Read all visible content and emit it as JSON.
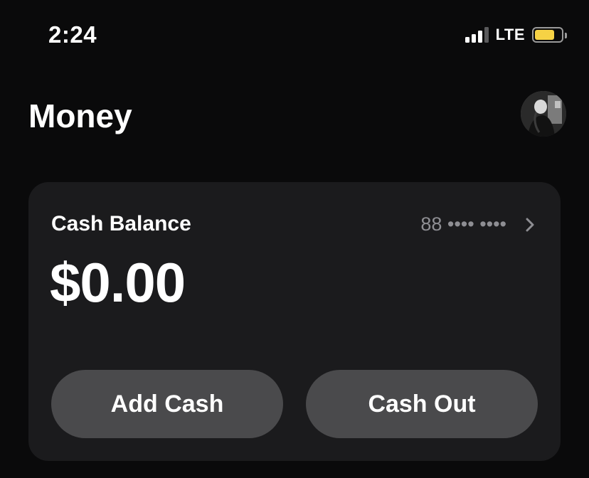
{
  "status_bar": {
    "time": "2:24",
    "network": "LTE",
    "signal_bars": 3,
    "battery_level": 0.75,
    "battery_color": "#f6d245"
  },
  "header": {
    "title": "Money",
    "avatar_icon": "profile-photo"
  },
  "card": {
    "label": "Cash Balance",
    "account_mask": "88 •••• ••••",
    "amount": "$0.00",
    "add_cash_label": "Add Cash",
    "cash_out_label": "Cash Out",
    "chevron_icon": "chevron-right-icon"
  },
  "colors": {
    "background": "#0a0a0b",
    "card": "#1b1b1d",
    "button": "#4a4a4c",
    "muted_text": "#8e8e93"
  }
}
